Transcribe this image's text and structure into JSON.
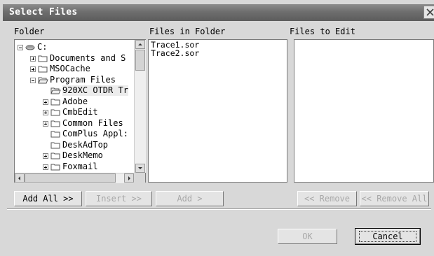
{
  "window": {
    "title": "Select Files"
  },
  "labels": {
    "folder": "Folder",
    "files_in_folder": "Files in Folder",
    "files_to_edit": "Files to Edit"
  },
  "tree": {
    "nodes": [
      {
        "label": "C:",
        "expander": "minus",
        "icon": "drive-icon"
      },
      {
        "label": "Documents and S",
        "expander": "plus",
        "icon": "folder-icon"
      },
      {
        "label": "MSOCache",
        "expander": "plus",
        "icon": "folder-icon"
      },
      {
        "label": "Program Files",
        "expander": "minus",
        "icon": "open-folder-icon"
      },
      {
        "label": "920XC OTDR Tr",
        "expander": "none",
        "icon": "open-folder-icon",
        "selected": true
      },
      {
        "label": "Adobe",
        "expander": "plus",
        "icon": "folder-icon"
      },
      {
        "label": "CmbEdit",
        "expander": "plus",
        "icon": "folder-icon"
      },
      {
        "label": "Common Files",
        "expander": "plus",
        "icon": "folder-icon"
      },
      {
        "label": "ComPlus Appl:",
        "expander": "none",
        "icon": "folder-icon"
      },
      {
        "label": "DeskAdTop",
        "expander": "none",
        "icon": "folder-icon"
      },
      {
        "label": "DeskMemo",
        "expander": "plus",
        "icon": "folder-icon"
      },
      {
        "label": "Foxmail",
        "expander": "plus",
        "icon": "folder-icon"
      }
    ]
  },
  "files_in_folder": [
    "Trace1.sor",
    "Trace2.sor"
  ],
  "files_to_edit": [],
  "buttons": {
    "add_all": "Add All >>",
    "insert": "Insert >>",
    "add": "Add >",
    "remove": "<< Remove",
    "remove_all": "<< Remove All",
    "ok": "OK",
    "cancel": "Cancel"
  }
}
